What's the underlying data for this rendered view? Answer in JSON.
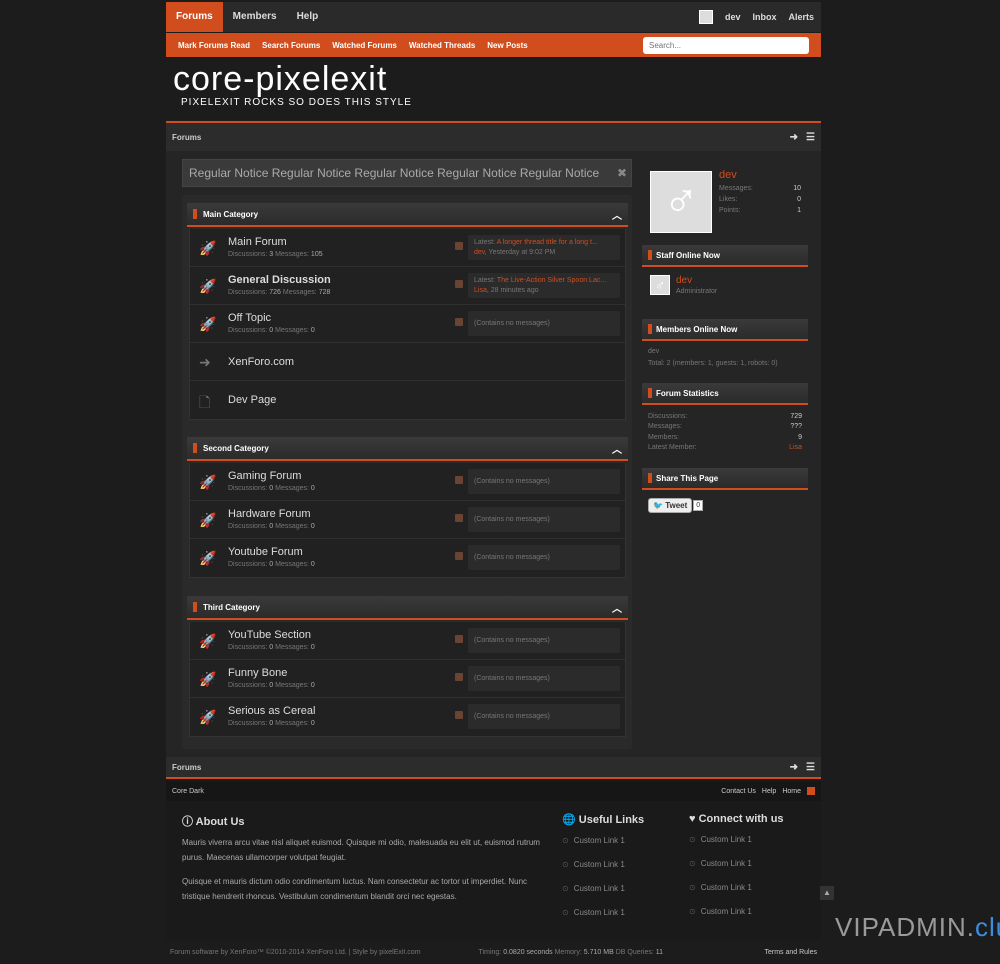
{
  "nav": {
    "tabs": [
      "Forums",
      "Members",
      "Help"
    ],
    "user": "dev",
    "inbox": "Inbox",
    "alerts": "Alerts"
  },
  "subnav": {
    "links": [
      "Mark Forums Read",
      "Search Forums",
      "Watched Forums",
      "Watched Threads",
      "New Posts"
    ],
    "search_placeholder": "Search..."
  },
  "logo": {
    "name": "core-pixelexit",
    "tagline": "PIXELEXIT ROCKS SO DOES THIS STYLE"
  },
  "breadcrumb": "Forums",
  "notice": "Regular Notice Regular Notice Regular Notice Regular Notice Regular Notice",
  "categories": [
    {
      "title": "Main Category",
      "nodes": [
        {
          "title": "Main Forum",
          "disc": "3",
          "msgs": "105",
          "latest": {
            "label": "Latest:",
            "title": "A longer thread title for a long t...",
            "user": "dev",
            "time": "Yesterday at 9:02 PM"
          }
        },
        {
          "title": "General Discussion",
          "disc": "726",
          "msgs": "728",
          "latest": {
            "label": "Latest:",
            "title": "The Live-Action Silver Spoon Lac...",
            "user": "Lisa",
            "time": "28 minutes ago"
          }
        },
        {
          "title": "Off Topic",
          "disc": "0",
          "msgs": "0",
          "empty": "(Contains no messages)"
        },
        {
          "title": "XenForo.com"
        },
        {
          "title": "Dev Page"
        }
      ]
    },
    {
      "title": "Second Category",
      "nodes": [
        {
          "title": "Gaming Forum",
          "disc": "0",
          "msgs": "0",
          "empty": "(Contains no messages)"
        },
        {
          "title": "Hardware Forum",
          "disc": "0",
          "msgs": "0",
          "empty": "(Contains no messages)"
        },
        {
          "title": "Youtube Forum",
          "disc": "0",
          "msgs": "0",
          "empty": "(Contains no messages)"
        }
      ]
    },
    {
      "title": "Third Category",
      "nodes": [
        {
          "title": "YouTube Section",
          "disc": "0",
          "msgs": "0",
          "empty": "(Contains no messages)"
        },
        {
          "title": "Funny Bone",
          "disc": "0",
          "msgs": "0",
          "empty": "(Contains no messages)"
        },
        {
          "title": "Serious as Cereal",
          "disc": "0",
          "msgs": "0",
          "empty": "(Contains no messages)"
        }
      ]
    }
  ],
  "labels": {
    "discussions": "Discussions:",
    "messages": "Messages:"
  },
  "sidebar": {
    "profile": {
      "name": "dev",
      "messages_label": "Messages:",
      "messages": "10",
      "likes_label": "Likes:",
      "likes": "0",
      "points_label": "Points:",
      "points": "1"
    },
    "staff": {
      "title": "Staff Online Now",
      "name": "dev",
      "role": "Administrator"
    },
    "members": {
      "title": "Members Online Now",
      "name": "dev",
      "total": "Total: 2 (members: 1, guests: 1, robots: 0)"
    },
    "stats": {
      "title": "Forum Statistics",
      "disc_label": "Discussions:",
      "disc": "729",
      "msgs_label": "Messages:",
      "msgs": "???",
      "members_label": "Members:",
      "members": "9",
      "latest_label": "Latest Member:",
      "latest": "Lisa"
    },
    "share": {
      "title": "Share This Page",
      "tweet": "Tweet",
      "count": "0"
    }
  },
  "footerbar": {
    "style": "Core Dark",
    "links": [
      "Contact Us",
      "Help",
      "Home"
    ]
  },
  "footer": {
    "about_title": "About Us",
    "about_p1": "Mauris viverra arcu vitae nisl aliquet euismod. Quisque mi odio, malesuada eu elit ut, euismod rutrum purus. Maecenas ullamcorper volutpat feugiat.",
    "about_p2": "Quisque et mauris dictum odio condimentum luctus. Nam consectetur ac tortor ut imperdiet. Nunc tristique hendrerit rhoncus. Vestibulum condimentum blandit orci nec egestas.",
    "useful_title": "Useful Links",
    "connect_title": "Connect with us",
    "link": "Custom Link 1"
  },
  "bottom": {
    "copyright": "Forum software by XenForo™ ©2010-2014 XenForo Ltd. | Style by pixelExit.com",
    "timing_label": "Timing:",
    "timing": "0.0820 seconds",
    "memory_label": "Memory:",
    "memory": "5.710 MB",
    "queries_label": "DB Queries:",
    "queries": "11",
    "terms": "Terms and Rules"
  },
  "watermark": {
    "a": "VIPADMIN.",
    "b": "club"
  }
}
